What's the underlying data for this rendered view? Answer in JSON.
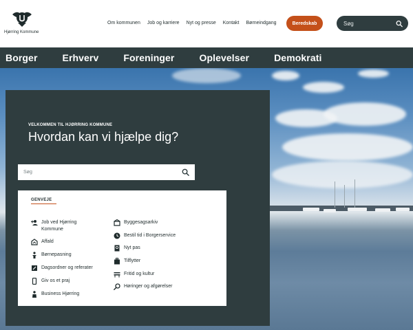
{
  "header": {
    "logo_text": "Hjørring Kommune",
    "logo_icon": "hjorring-crest",
    "links": [
      "Om kommunen",
      "Job og karriere",
      "Nyt og presse",
      "Kontakt",
      "Børneindgang"
    ],
    "beredskab_label": "Beredskab",
    "search_placeholder": "Søg"
  },
  "nav": {
    "items": [
      "Borger",
      "Erhverv",
      "Foreninger",
      "Oplevelser",
      "Demokrati"
    ]
  },
  "hero": {
    "welcome": "VELKOMMEN TIL HJØRRING KOMMUNE",
    "headline": "Hvordan kan vi hjælpe dig?",
    "search_placeholder": "Søg"
  },
  "shortcuts": {
    "title": "GENVEJE",
    "left": [
      {
        "label": "Job ved Hjørring Kommune",
        "icon": "person-add-icon"
      },
      {
        "label": "Affald",
        "icon": "recycle-icon"
      },
      {
        "label": "Børnepasning",
        "icon": "child-icon"
      },
      {
        "label": "Dagsordner og referater",
        "icon": "edit-icon"
      },
      {
        "label": "Giv os et praj",
        "icon": "phone-icon"
      },
      {
        "label": "Business Hjørring",
        "icon": "business-icon"
      }
    ],
    "right": [
      {
        "label": "Byggesagsarkiv",
        "icon": "crane-icon"
      },
      {
        "label": "Bestil tid i Borgerservice",
        "icon": "clock-icon"
      },
      {
        "label": "Nyt pas",
        "icon": "passport-icon"
      },
      {
        "label": "Tilflytter",
        "icon": "luggage-icon"
      },
      {
        "label": "Fritid og kultur",
        "icon": "bench-icon"
      },
      {
        "label": "Høringer og afgørelser",
        "icon": "search-icon"
      }
    ]
  },
  "colors": {
    "dark": "#2f3d3f",
    "accent": "#c4501a"
  }
}
